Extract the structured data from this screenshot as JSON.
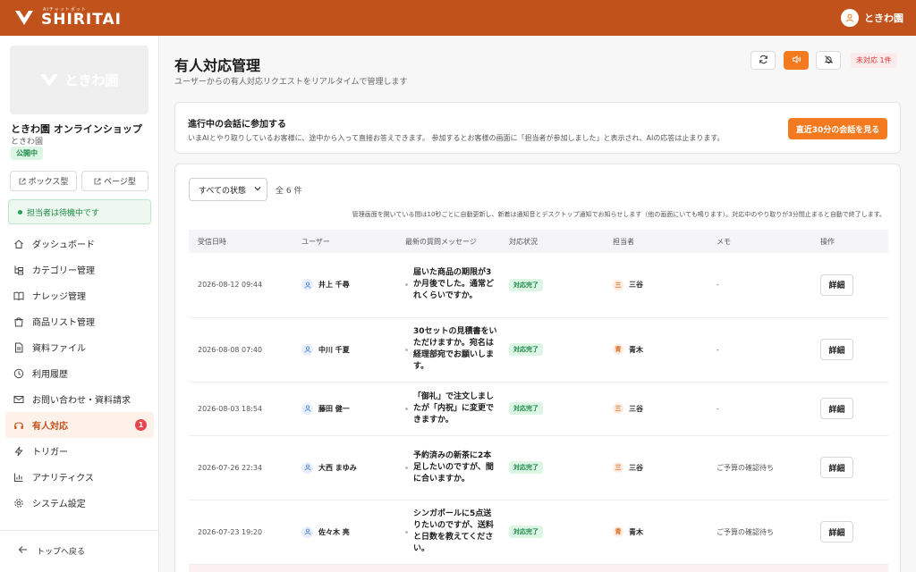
{
  "header": {
    "brand_sub": "AIチャットボット",
    "brand_name": "SHIRITAI",
    "user_name": "ときわ園"
  },
  "sidebar": {
    "logo_text": "ときわ園",
    "store_name": "ときわ園 オンラインショップ",
    "store_sub": "ときわ園",
    "public_badge": "公開中",
    "box_type_label": "ボックス型",
    "page_type_label": "ページ型",
    "staff_status": "担当者は待機中です",
    "items": [
      {
        "label": "ダッシュボード",
        "icon": "home-icon"
      },
      {
        "label": "カテゴリー管理",
        "icon": "category-tree-icon"
      },
      {
        "label": "ナレッジ管理",
        "icon": "book-icon"
      },
      {
        "label": "商品リスト管理",
        "icon": "shopping-bag-icon"
      },
      {
        "label": "資料ファイル",
        "icon": "file-icon"
      },
      {
        "label": "利用履歴",
        "icon": "clock-icon"
      },
      {
        "label": "お問い合わせ・資料請求",
        "icon": "mail-icon"
      },
      {
        "label": "有人対応",
        "icon": "headset-icon",
        "badge": "1"
      },
      {
        "label": "トリガー",
        "icon": "lightning-icon"
      },
      {
        "label": "アナリティクス",
        "icon": "bar-chart-icon"
      },
      {
        "label": "システム設定",
        "icon": "gear-icon"
      }
    ],
    "back_label": "トップへ戻る"
  },
  "main": {
    "title": "有人対応管理",
    "subtitle": "ユーザーからの有人対応リクエストをリアルタイムで管理します",
    "unhandled_badge": "未対応 1件",
    "join": {
      "title": "進行中の会話に参加する",
      "description": "いまAIとやり取りしているお客様に、途中から入って直接お答えできます。 参加するとお客様の画面に「担当者が参加しました」と表示され、AIの応答は止まります。",
      "button": "直近30分の会話を見る"
    },
    "filter": {
      "selected": "すべての状態",
      "total": "全 6 件"
    },
    "note": "管理画面を開いている間は10秒ごとに自動更新し、新着は通知音とデスクトップ通知でお知らせします（他の画面にいても鳴ります）。対応中のやり取りが3分間止まると自動で終了します。",
    "columns": [
      "受信日時",
      "ユーザー",
      "最新の質問メッセージ",
      "対応状況",
      "担当者",
      "メモ",
      "操作"
    ],
    "rows": [
      {
        "datetime": "2026-08-12 09:44",
        "user": "井上 千尋",
        "message": "届いた商品の期限が3か月後でした。通常どれくらいですか。",
        "status": "対応完了",
        "staff": "三谷",
        "staff_initial": "三",
        "memo": "-",
        "action": "詳細"
      },
      {
        "datetime": "2026-08-08 07:40",
        "user": "中川 千夏",
        "message": "30セットの見積書をいただけますか。宛名は経理部宛でお願いします。",
        "status": "対応完了",
        "staff": "青木",
        "staff_initial": "青",
        "memo": "-",
        "action": "詳細"
      },
      {
        "datetime": "2026-08-03 18:54",
        "user": "藤田 健一",
        "message": "「御礼」で注文しましたが「内祝」に変更できますか。",
        "status": "対応完了",
        "staff": "三谷",
        "staff_initial": "三",
        "memo": "-",
        "action": "詳細"
      },
      {
        "datetime": "2026-07-26 22:34",
        "user": "大西 まゆみ",
        "message": "予約済みの新茶に2本足したいのですが、間に合いますか。",
        "status": "対応完了",
        "staff": "三谷",
        "staff_initial": "三",
        "memo": "ご予算の確認待ち",
        "action": "詳細"
      },
      {
        "datetime": "2026-07-23 19:20",
        "user": "佐々木 亮",
        "message": "シンガポールに5点送りたいのですが、送料と日数を教えてください。",
        "status": "対応完了",
        "staff": "青木",
        "staff_initial": "青",
        "memo": "ご予算の確認待ち",
        "action": "詳細"
      }
    ]
  }
}
